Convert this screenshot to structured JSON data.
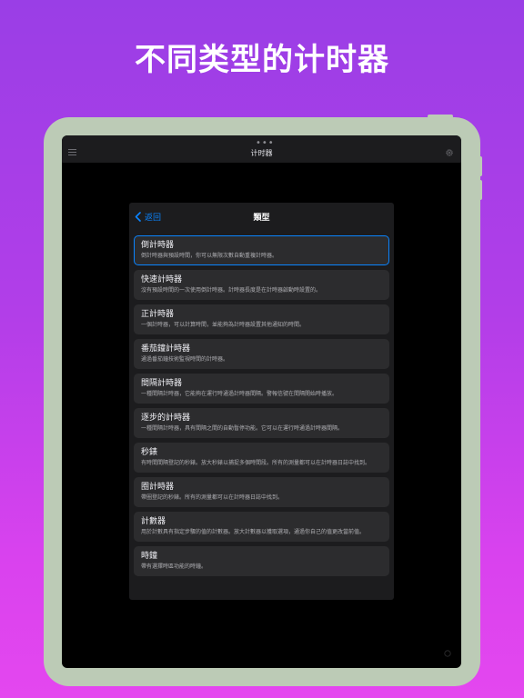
{
  "headline": "不同类型的计时器",
  "app": {
    "title": "计时器",
    "dots": "•••"
  },
  "modal": {
    "back_label": "返回",
    "title": "類型",
    "items": [
      {
        "title": "倒計時器",
        "desc": "倒計時器與預設時間，你可以無限次數自動重複計時器。",
        "selected": true
      },
      {
        "title": "快速計時器",
        "desc": "沒有預設時間的一次使用倒計時器。計時器長度是在計時器啟動時設置的。",
        "selected": false
      },
      {
        "title": "正計時器",
        "desc": "一個計時器，可以計算時間，並能夠為計時器設置其他通知的時間。",
        "selected": false
      },
      {
        "title": "番茄鐘計時器",
        "desc": "通過番茄鐘技術監視時間的計時器。",
        "selected": false
      },
      {
        "title": "間隔計時器",
        "desc": "一種間隔計時器，它能夠在運行時通過計時器間隔。警報信號在間隔開始時播放。",
        "selected": false
      },
      {
        "title": "逐步的計時器",
        "desc": "一種間隔計時器，具有間隔之間的自動暫停功能。它可以在運行時通過計時器間隔。",
        "selected": false
      },
      {
        "title": "秒錶",
        "desc": "有時間間隔登記的秒錶。放大秒錶以捕捉多個時間段。所有的測量都可以在計時器日誌中找到。",
        "selected": false
      },
      {
        "title": "圈計時器",
        "desc": "帶圈登記的秒錶。所有的測量都可以在計時器日誌中找到。",
        "selected": false
      },
      {
        "title": "計數器",
        "desc": "用於計數具有指定步驟的值的計數器。放大計數器以獲取選項，通過你自己的值更改當前值。",
        "selected": false
      },
      {
        "title": "時鐘",
        "desc": "帶有選擇時區功能的時鐘。",
        "selected": false
      }
    ]
  },
  "colors": {
    "accent": "#0a84ff",
    "device_frame": "#bccbb6",
    "background_top": "#9a3ee6",
    "background_bottom": "#e447ef"
  },
  "icons": {
    "menu": "hamburger-menu-icon",
    "settings": "gear-icon",
    "back": "chevron-left-icon"
  }
}
